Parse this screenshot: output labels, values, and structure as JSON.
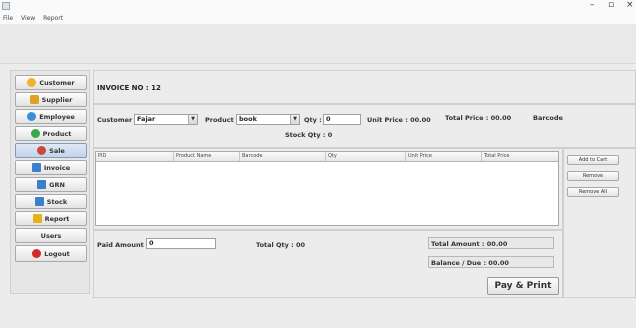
{
  "window": {
    "minimize_glyph": "–",
    "maximize_glyph": "▫",
    "close_glyph": "×"
  },
  "menu": [
    "File",
    "View",
    "Report"
  ],
  "sidebar": {
    "items": [
      {
        "label": "Customer",
        "icon": "customer-icon",
        "color": "#f0b428"
      },
      {
        "label": "Supplier",
        "icon": "supplier-icon",
        "color": "#e0a020"
      },
      {
        "label": "Employee",
        "icon": "employee-icon",
        "color": "#3a8fd8"
      },
      {
        "label": "Product",
        "icon": "product-icon",
        "color": "#3aa84a"
      },
      {
        "label": "Sale",
        "icon": "sale-icon",
        "color": "#d0483a"
      },
      {
        "label": "Invoice",
        "icon": "invoice-icon",
        "color": "#3a7fd0"
      },
      {
        "label": "GRN",
        "icon": "grn-icon",
        "color": "#3a7fd0"
      },
      {
        "label": "Stock",
        "icon": "stock-icon",
        "color": "#3a7fd0"
      },
      {
        "label": "Report",
        "icon": "report-icon",
        "color": "#e8b020"
      },
      {
        "label": "Users",
        "icon": "",
        "color": ""
      },
      {
        "label": "Logout",
        "icon": "logout-icon",
        "color": "#d02a2a"
      }
    ]
  },
  "invoice": {
    "number_label": "INVOICE NO : 12"
  },
  "form": {
    "customer_label": "Customer :",
    "customer_value": "Fajar",
    "product_label": "Product :",
    "product_value": "book",
    "qty_label": "Qty :",
    "qty_value": "0",
    "unit_price": "Unit Price : 00.00",
    "total_price": "Total Price : 00.00",
    "barcode_label": "Barcode",
    "stock_qty": "Stock Qty : 0"
  },
  "table": {
    "columns": [
      "PID",
      "Product Name",
      "Barcode",
      "Qty",
      "Unit Price",
      "Total Price"
    ]
  },
  "actions": {
    "add": "Add to Cart",
    "remove": "Remove",
    "remove_all": "Remove All"
  },
  "summary": {
    "paid_label": "Paid Amount :",
    "paid_value": "0",
    "total_qty": "Total Qty : 00",
    "total_amount": "Total Amount : 00.00",
    "balance": "Balance / Due : 00.00"
  },
  "pay_button": "Pay & Print"
}
